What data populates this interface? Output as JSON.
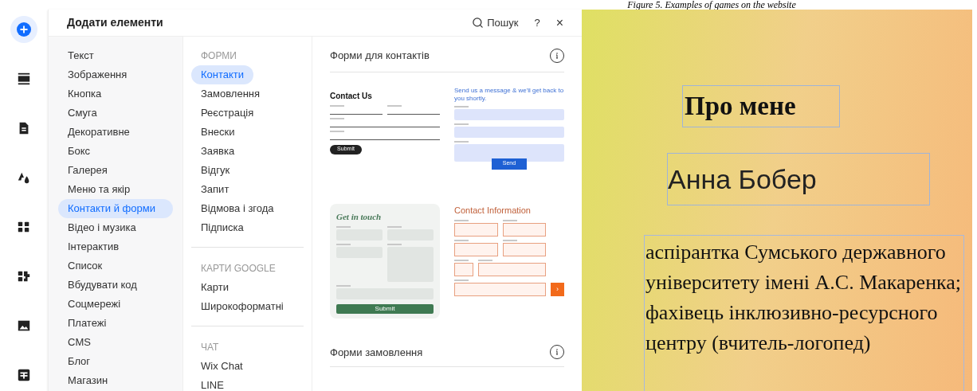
{
  "caption": "Figure 5. Examples of games on the website",
  "rail": [
    {
      "kind": "add",
      "selected": true
    },
    {
      "kind": "strips",
      "selected": false
    },
    {
      "kind": "page",
      "selected": false
    },
    {
      "kind": "theme",
      "selected": false
    },
    {
      "kind": "apps",
      "selected": false
    },
    {
      "kind": "puzzle",
      "selected": false
    },
    {
      "kind": "image",
      "selected": false
    },
    {
      "kind": "table",
      "selected": false
    }
  ],
  "panel": {
    "title": "Додати елементи",
    "search": "Пошук",
    "help": "?",
    "close": "×"
  },
  "categories": [
    {
      "label": "Текст",
      "selected": false
    },
    {
      "label": "Зображення",
      "selected": false
    },
    {
      "label": "Кнопка",
      "selected": false
    },
    {
      "label": "Смуга",
      "selected": false
    },
    {
      "label": "Декоративне",
      "selected": false
    },
    {
      "label": "Бокс",
      "selected": false
    },
    {
      "label": "Галерея",
      "selected": false
    },
    {
      "label": "Меню та якір",
      "selected": false
    },
    {
      "label": "Контакти й форми",
      "selected": true
    },
    {
      "label": "Відео і музика",
      "selected": false
    },
    {
      "label": "Інтерактив",
      "selected": false
    },
    {
      "label": "Список",
      "selected": false
    },
    {
      "label": "Вбудувати код",
      "selected": false
    },
    {
      "label": "Соцмережі",
      "selected": false
    },
    {
      "label": "Платежі",
      "selected": false
    },
    {
      "label": "CMS",
      "selected": false
    },
    {
      "label": "Блог",
      "selected": false
    },
    {
      "label": "Магазин",
      "selected": false
    }
  ],
  "sections": [
    {
      "heading": "ФОРМИ",
      "items": [
        {
          "label": "Контакти",
          "selected": true
        },
        {
          "label": "Замовлення",
          "selected": false
        },
        {
          "label": "Реєстрація",
          "selected": false
        },
        {
          "label": "Внески",
          "selected": false
        },
        {
          "label": "Заявка",
          "selected": false
        },
        {
          "label": "Відгук",
          "selected": false
        },
        {
          "label": "Запит",
          "selected": false
        },
        {
          "label": "Відмова і згода",
          "selected": false
        },
        {
          "label": "Підписка",
          "selected": false
        }
      ]
    },
    {
      "heading": "КАРТИ GOOGLE",
      "items": [
        {
          "label": "Карти",
          "selected": false
        },
        {
          "label": "Широкоформатні",
          "selected": false
        }
      ]
    },
    {
      "heading": "ЧАТ",
      "items": [
        {
          "label": "Wix Chat",
          "selected": false
        },
        {
          "label": "LINE",
          "selected": false
        }
      ]
    }
  ],
  "preview_groups": [
    {
      "title": "Форми для контактів"
    },
    {
      "title": "Форми замовлення"
    }
  ],
  "templates": [
    {
      "kind": "underline",
      "title": "Contact Us",
      "button": "Submit"
    },
    {
      "kind": "filled",
      "title": "Send us a message & we'll get back to you shortly.",
      "button": "Send"
    },
    {
      "kind": "card",
      "title": "Get in touch",
      "button": "Submit"
    },
    {
      "kind": "outlined",
      "title": "Contact Information",
      "button": "›"
    }
  ],
  "canvas": {
    "heading": "Про мене",
    "name": "Анна Бобер",
    "bio": "аспірантка Сумського державного університету імені А.С. Макаренка; фахівець інклюзивно-ресурсного центру (вчитель-логопед)"
  }
}
